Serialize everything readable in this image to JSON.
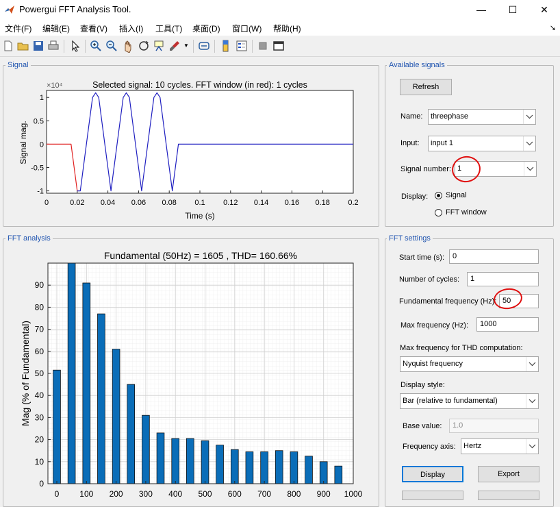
{
  "window": {
    "title": "Powergui FFT Analysis Tool.",
    "buttons": [
      "—",
      "☐",
      "✕"
    ]
  },
  "menu": [
    "文件(F)",
    "编辑(E)",
    "查看(V)",
    "插入(I)",
    "工具(T)",
    "桌面(D)",
    "窗口(W)",
    "帮助(H)"
  ],
  "toolbar_icons": [
    "new-file-icon",
    "open-folder-icon",
    "save-icon",
    "print-icon",
    "pointer-icon",
    "zoom-in-icon",
    "zoom-out-icon",
    "pan-icon",
    "rotate-icon",
    "data-cursor-icon",
    "brush-icon",
    "link-icon",
    "colorbar-icon",
    "legend-icon",
    "hide-plot-icon",
    "show-plot-icon"
  ],
  "signal_panel": {
    "title": "Signal",
    "plot_title": "Selected signal: 10 cycles. FFT window (in red): 1 cycles",
    "exponent": "×10⁴",
    "ylabel": "Signal mag.",
    "xlabel": "Time (s)"
  },
  "fft_panel": {
    "title": "FFT analysis",
    "plot_title": "Fundamental (50Hz) = 1605 , THD= 160.66%",
    "ylabel": "Mag (% of Fundamental)"
  },
  "available": {
    "title": "Available signals",
    "refresh": "Refresh",
    "name_label": "Name:",
    "name_value": "threephase",
    "input_label": "Input:",
    "input_value": "input 1",
    "signum_label": "Signal number:",
    "signum_value": "1",
    "display_label": "Display:",
    "opt_signal": "Signal",
    "opt_fft": "FFT window"
  },
  "fft_settings": {
    "title": "FFT settings",
    "start_label": "Start time (s):",
    "start_value": "0",
    "cycles_label": "Number of cycles:",
    "cycles_value": "1",
    "fund_label": "Fundamental frequency (Hz):",
    "fund_value": "50",
    "maxf_label": "Max frequency (Hz):",
    "maxf_value": "1000",
    "thd_label": "Max frequency for THD computation:",
    "thd_value": "Nyquist frequency",
    "style_label": "Display style:",
    "style_value": "Bar (relative to fundamental)",
    "base_label": "Base value:",
    "base_value": "1.0",
    "axis_label": "Frequency axis:",
    "axis_value": "Hertz",
    "display_btn": "Display",
    "export_btn": "Export"
  },
  "chart_data": [
    {
      "type": "line",
      "title": "Selected signal: 10 cycles. FFT window (in red): 1 cycles",
      "xlabel": "Time (s)",
      "ylabel": "Signal mag.",
      "y_exponent_label": "×10⁴",
      "xlim": [
        0,
        0.2
      ],
      "ylim": [
        -1.05,
        1.15
      ],
      "xticks": [
        0,
        0.02,
        0.04,
        0.06,
        0.08,
        0.1,
        0.12,
        0.14,
        0.16,
        0.18,
        0.2
      ],
      "yticks": [
        -1,
        -0.5,
        0,
        0.5,
        1
      ],
      "grid": false,
      "series": [
        {
          "color": "#e02020",
          "x": [
            0,
            0.016,
            0.02
          ],
          "y": [
            0,
            0,
            -1.0
          ]
        },
        {
          "color": "#1f1fc0",
          "x": [
            0.02,
            0.022,
            0.026,
            0.03,
            0.032,
            0.034,
            0.038,
            0.042,
            0.046,
            0.05,
            0.052,
            0.054,
            0.058,
            0.062,
            0.066,
            0.07,
            0.072,
            0.074,
            0.078,
            0.082,
            0.086,
            0.087,
            0.2
          ],
          "y": [
            -1.0,
            -1.0,
            0.0,
            1.0,
            1.1,
            1.0,
            0.0,
            -1.0,
            0.0,
            1.0,
            1.1,
            1.0,
            0.0,
            -1.0,
            0.0,
            1.0,
            1.1,
            1.0,
            0.0,
            -1.0,
            0.0,
            0,
            0
          ]
        }
      ]
    },
    {
      "type": "bar",
      "title": "Fundamental (50Hz) = 1605 , THD= 160.66%",
      "ylabel": "Mag (% of Fundamental)",
      "xlim": [
        -30,
        1000
      ],
      "ylim": [
        0,
        100
      ],
      "xticks": [
        0,
        100,
        200,
        300,
        400,
        500,
        600,
        700,
        800,
        900,
        1000
      ],
      "yticks": [
        0,
        10,
        20,
        30,
        40,
        50,
        60,
        70,
        80,
        90
      ],
      "grid": true,
      "bar_color": "#0a6db8",
      "x": [
        0,
        50,
        100,
        150,
        200,
        250,
        300,
        350,
        400,
        450,
        500,
        550,
        600,
        650,
        700,
        750,
        800,
        850,
        900,
        950
      ],
      "values": [
        51.5,
        100,
        91,
        77,
        61,
        45,
        31,
        23,
        20.5,
        20.5,
        19.5,
        17.5,
        15.5,
        14.5,
        14.5,
        15,
        14.5,
        12.5,
        10,
        8
      ]
    }
  ]
}
